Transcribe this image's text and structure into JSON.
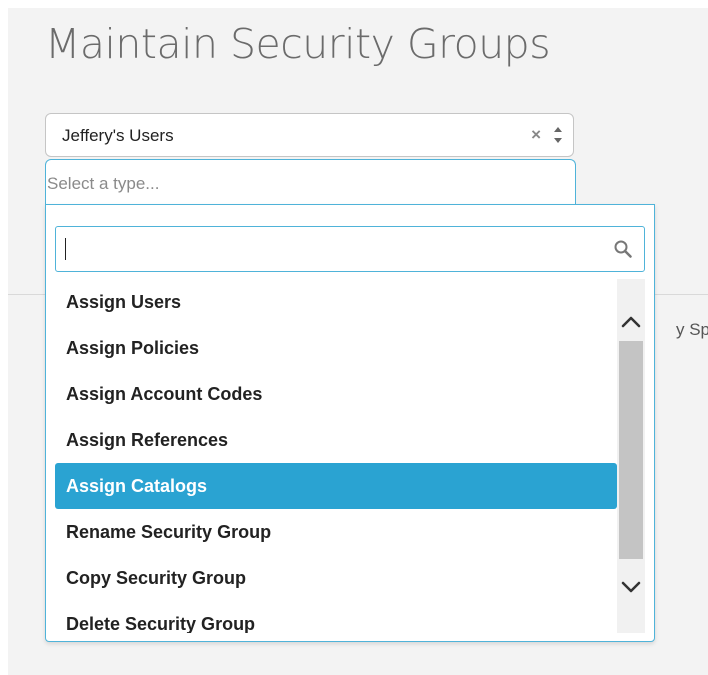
{
  "page": {
    "title": "Maintain Security Groups",
    "behind_text": "y Spe"
  },
  "group_select": {
    "value": "Jeffery's Users",
    "clear_glyph": "×"
  },
  "type_select": {
    "placeholder": "Select a type..."
  },
  "dropdown": {
    "search_value": "",
    "options": [
      {
        "label": "Assign Users",
        "selected": false
      },
      {
        "label": "Assign Policies",
        "selected": false
      },
      {
        "label": "Assign Account Codes",
        "selected": false
      },
      {
        "label": "Assign References",
        "selected": false
      },
      {
        "label": "Assign Catalogs",
        "selected": true
      },
      {
        "label": "Rename Security Group",
        "selected": false
      },
      {
        "label": "Copy Security Group",
        "selected": false
      },
      {
        "label": "Delete Security Group",
        "selected": false
      }
    ]
  },
  "icons": {
    "clear": "close-icon",
    "sort": "up-down-arrows-icon",
    "search": "search-icon",
    "scroll_up": "chevron-up-icon",
    "scroll_down": "chevron-down-icon"
  },
  "colors": {
    "focus_border": "#4fb3d9",
    "selected_background": "#2aa3d2",
    "selected_text": "#ffffff",
    "title_text": "#6b6b6b",
    "panel_background": "#f3f3f3"
  }
}
